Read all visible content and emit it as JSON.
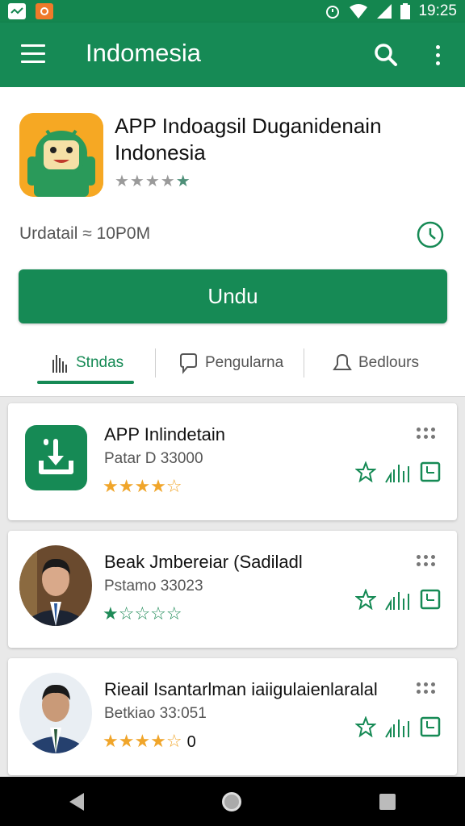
{
  "status_bar": {
    "time": "19:25",
    "wifi_icon": "wifi-icon",
    "signal_icon": "signal-icon",
    "battery_icon": "battery-icon",
    "alarm_icon": "alarm-icon"
  },
  "app_bar": {
    "title": "Indomesia",
    "menu_icon": "menu-icon",
    "search_icon": "search-icon",
    "more_icon": "more-vert-icon"
  },
  "app": {
    "name": "APP Indoagsil Duganidenain Indonesia",
    "rating_stars": 5,
    "update_text": "Urdatail ≈ 10P0M",
    "download_label": "Undu"
  },
  "tabs": [
    {
      "label": "Stndas",
      "icon": "hand-icon",
      "active": true
    },
    {
      "label": "Pengularna",
      "icon": "chat-icon",
      "active": false
    },
    {
      "label": "Bedlours",
      "icon": "bell-icon",
      "active": false
    }
  ],
  "items": [
    {
      "title": "APP Inlindetain",
      "subtitle": "Patar D 33000",
      "rating": 4.5,
      "rating_color": "#f0a52a",
      "count": "",
      "icon": "download-icon"
    },
    {
      "title": "Beak Jmbereiar (Sadiladl",
      "subtitle": "Pstamo 33023",
      "rating": 1,
      "rating_color": "#1e8a57",
      "count": "",
      "icon": "avatar"
    },
    {
      "title": "Rieail Isantarlman iaiigulaienlaralal",
      "subtitle": "Betkiao 33:051",
      "rating": 4.5,
      "rating_color": "#f0a52a",
      "count": "0",
      "icon": "avatar"
    }
  ],
  "colors": {
    "primary": "#168a55",
    "status_bar": "#14864f",
    "star_gold": "#f0a52a"
  }
}
